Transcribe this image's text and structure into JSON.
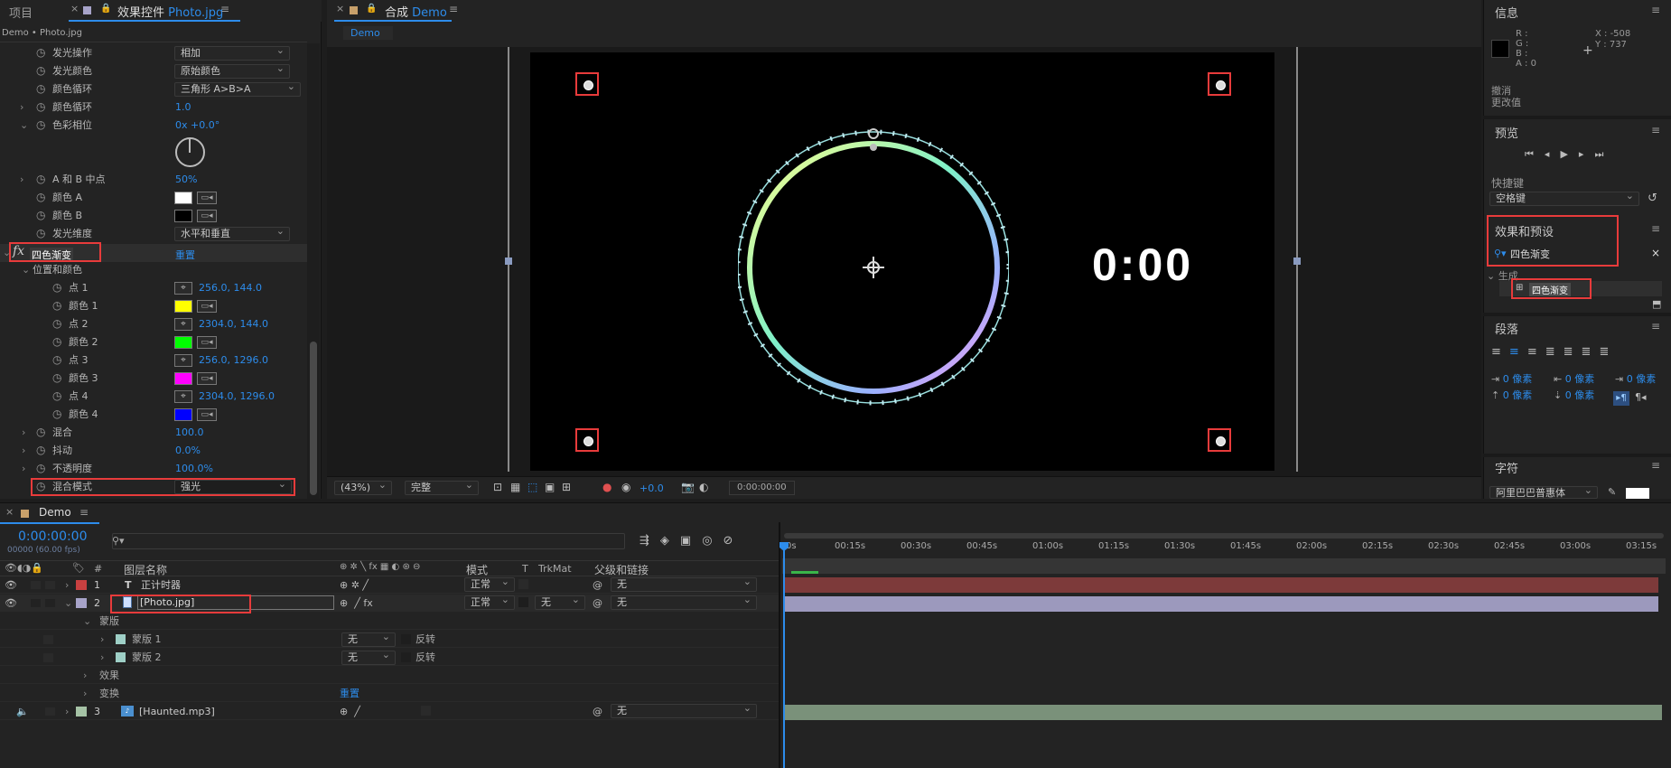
{
  "top_tabs": {
    "project": "项目",
    "effects": "效果控件",
    "effects_file": "Photo.jpg",
    "comp": "合成",
    "comp_name": "Demo"
  },
  "fx_panel": {
    "breadcrumb": "Demo • Photo.jpg",
    "rows": [
      {
        "label": "发光操作",
        "select": "相加"
      },
      {
        "label": "发光颜色",
        "select": "原始颜色"
      },
      {
        "label": "颜色循环",
        "select": "三角形 A>B>A"
      },
      {
        "label": "颜色循环",
        "value": "1.0"
      },
      {
        "label": "色彩相位",
        "value": "0x +0.0°"
      },
      {
        "label": "A 和 B 中点",
        "value": "50%"
      },
      {
        "label": "颜色 A"
      },
      {
        "label": "颜色 B"
      },
      {
        "label": "发光维度",
        "select": "水平和垂直"
      }
    ],
    "effect_name": "四色渐变",
    "reset": "重置",
    "group": "位置和颜色",
    "points": [
      {
        "label": "点 1",
        "value": "256.0, 144.0"
      },
      {
        "label": "颜色 1",
        "color": "#ffff00"
      },
      {
        "label": "点 2",
        "value": "2304.0, 144.0"
      },
      {
        "label": "颜色 2",
        "color": "#00ff00"
      },
      {
        "label": "点 3",
        "value": "256.0, 1296.0"
      },
      {
        "label": "颜色 3",
        "color": "#ff00ff"
      },
      {
        "label": "点 4",
        "value": "2304.0, 1296.0"
      },
      {
        "label": "颜色 4",
        "color": "#0000ff"
      }
    ],
    "tail": [
      {
        "label": "混合",
        "value": "100.0"
      },
      {
        "label": "抖动",
        "value": "0.0%"
      },
      {
        "label": "不透明度",
        "value": "100.0%"
      }
    ],
    "blend_label": "混合模式",
    "blend_value": "强光"
  },
  "viewer": {
    "comp_tab": "Demo",
    "timer_text": "0:00",
    "zoom": "(43%)",
    "quality": "完整",
    "exposure": "+0.0",
    "timecode": "0:00:00:00"
  },
  "right": {
    "info_title": "信息",
    "rgba": [
      "R :",
      "G :",
      "B :",
      "A : 0"
    ],
    "xy": [
      "X : -508",
      "Y : 737"
    ],
    "undo": "撤消",
    "undo2": "更改值",
    "preview_title": "预览",
    "shortcut_label": "快捷键",
    "shortcut_value": "空格键",
    "effects_title": "效果和预设",
    "search_value": "四色渐变",
    "category": "生成",
    "result": "四色渐变",
    "para_title": "段落",
    "indent": [
      "0 像素",
      "0 像素",
      "0 像素",
      "0 像素",
      "0 像素"
    ],
    "char_title": "字符",
    "font": "阿里巴巴普惠体"
  },
  "timeline": {
    "tab": "Demo",
    "time": "0:00:00:00",
    "fps": "00000 (60.00 fps)",
    "col_num": "#",
    "col_name": "图层名称",
    "col_mode": "模式",
    "col_t": "T",
    "col_trk": "TrkMat",
    "col_parent": "父级和链接",
    "ticks": [
      "0s",
      "00:15s",
      "00:30s",
      "00:45s",
      "01:00s",
      "01:15s",
      "01:30s",
      "01:45s",
      "02:00s",
      "02:15s",
      "02:30s",
      "02:45s",
      "03:00s",
      "03:15s"
    ],
    "layers": [
      {
        "num": "1",
        "name": "正计时器",
        "mode": "正常",
        "parent": "无",
        "color": "#c94040"
      },
      {
        "num": "2",
        "name": "[Photo.jpg]",
        "mode": "正常",
        "trk": "无",
        "parent": "无",
        "color": "#a7a3c9"
      },
      {
        "num": "3",
        "name": "[Haunted.mp3]",
        "parent": "无",
        "color": "#a6c3a6"
      }
    ],
    "mask_group": "蒙版",
    "masks": [
      {
        "name": "蒙版 1",
        "mode": "无",
        "inv": "反转"
      },
      {
        "name": "蒙版 2",
        "mode": "无",
        "inv": "反转"
      }
    ],
    "effects_label": "效果",
    "transform_label": "变换",
    "transform_reset": "重置"
  }
}
